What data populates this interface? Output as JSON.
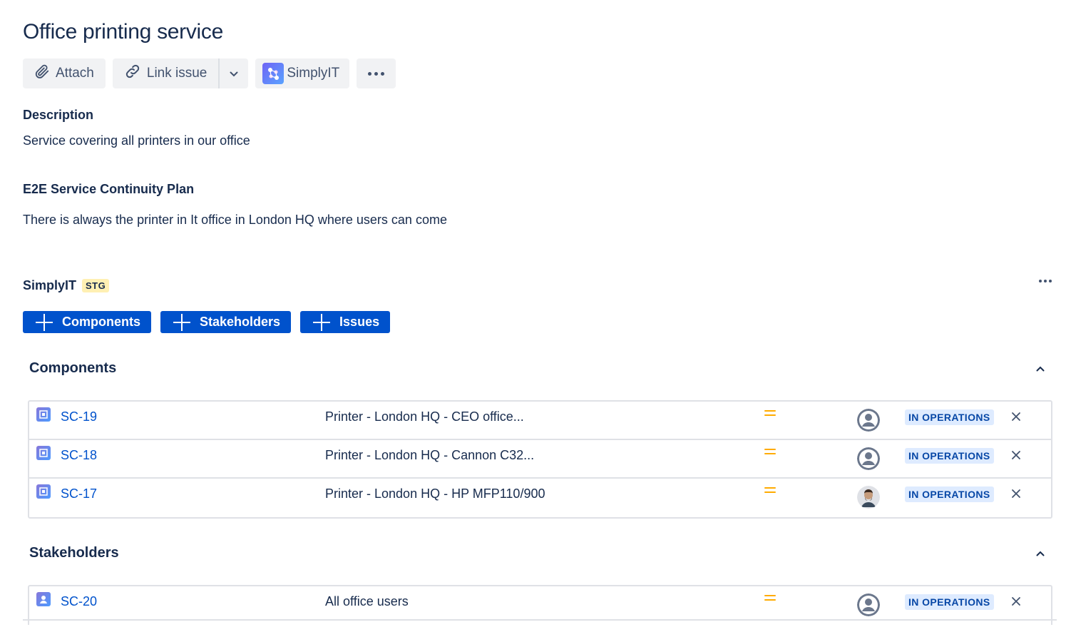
{
  "page": {
    "title": "Office printing service"
  },
  "toolbar": {
    "attach_label": "Attach",
    "link_issue_label": "Link issue",
    "simplyit_label": "SimplyIT"
  },
  "description": {
    "label": "Description",
    "text": "Service covering all printers in our office"
  },
  "continuity": {
    "label": "E2E Service Continuity Plan",
    "text": "There is always the printer in It office in London HQ where users can come"
  },
  "app_panel": {
    "title": "SimplyIT",
    "badge": "STG",
    "buttons": [
      "Components",
      "Stakeholders",
      "Issues"
    ]
  },
  "components": {
    "title": "Components",
    "rows": [
      {
        "key": "SC-19",
        "summary": "Printer - London HQ - CEO office...",
        "status": "IN OPERATIONS",
        "avatar": "default-avatar"
      },
      {
        "key": "SC-18",
        "summary": "Printer - London HQ - Cannon C32...",
        "status": "IN OPERATIONS",
        "avatar": "default-avatar"
      },
      {
        "key": "SC-17",
        "summary": "Printer - London HQ - HP MFP110/900",
        "status": "IN OPERATIONS",
        "avatar": "user-photo-avatar"
      }
    ]
  },
  "stakeholders": {
    "title": "Stakeholders",
    "rows": [
      {
        "key": "SC-20",
        "summary": "All office users",
        "status": "IN OPERATIONS",
        "avatar": "default-avatar"
      }
    ]
  },
  "colors": {
    "primary": "#0052cc",
    "priority_medium": "#ffab00",
    "status_bg": "#deebff",
    "status_text": "#0747a6",
    "badge_bg": "#fff0b3"
  }
}
